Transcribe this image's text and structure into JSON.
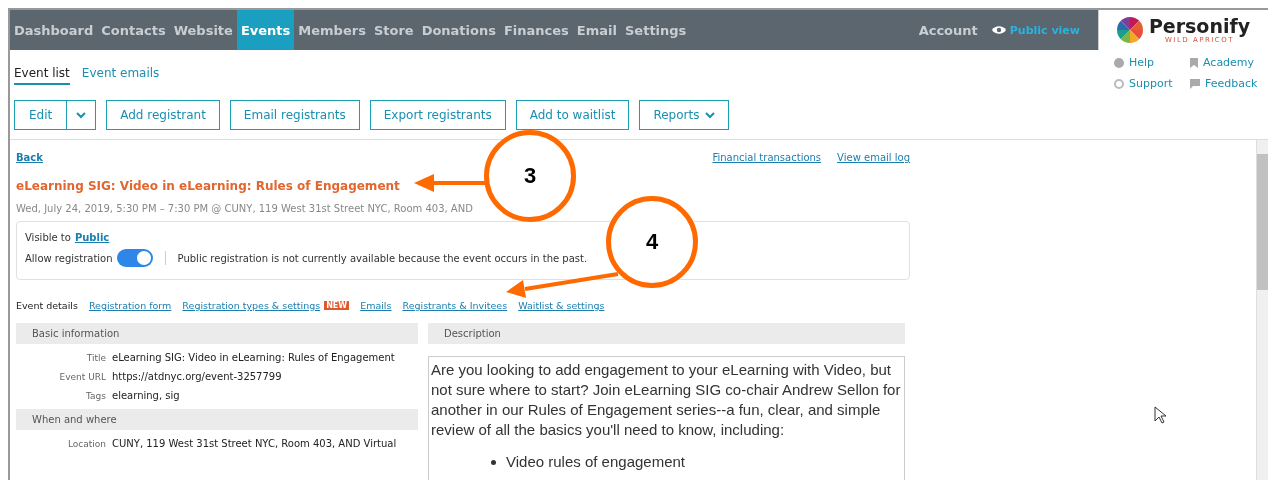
{
  "nav": {
    "items": [
      {
        "label": "Dashboard",
        "selected": false
      },
      {
        "label": "Contacts",
        "selected": false
      },
      {
        "label": "Website",
        "selected": false
      },
      {
        "label": "Events",
        "selected": true
      },
      {
        "label": "Members",
        "selected": false
      },
      {
        "label": "Store",
        "selected": false
      },
      {
        "label": "Donations",
        "selected": false
      },
      {
        "label": "Finances",
        "selected": false
      },
      {
        "label": "Email",
        "selected": false
      },
      {
        "label": "Settings",
        "selected": false
      }
    ],
    "account": "Account",
    "public_view": "Public view",
    "logo": {
      "name": "Personify",
      "tagline": "WILD APRICOT"
    }
  },
  "help_links": [
    {
      "label": "Help",
      "kind": "help"
    },
    {
      "label": "Academy",
      "kind": "bookmark"
    },
    {
      "label": "Support",
      "kind": "lifebuoy"
    },
    {
      "label": "Feedback",
      "kind": "comment"
    }
  ],
  "subtabs": [
    {
      "label": "Event list",
      "selected": true
    },
    {
      "label": "Event emails",
      "selected": false
    }
  ],
  "toolbar": [
    {
      "label": "Edit",
      "kind": "split"
    },
    {
      "label": "Add registrant",
      "kind": "plain"
    },
    {
      "label": "Email registrants",
      "kind": "plain"
    },
    {
      "label": "Export registrants",
      "kind": "plain"
    },
    {
      "label": "Add to waitlist",
      "kind": "plain"
    },
    {
      "label": "Reports",
      "kind": "dropdown"
    }
  ],
  "back": "Back",
  "top_links": [
    "Financial transactions",
    "View email log"
  ],
  "event": {
    "title": "eLearning SIG: Video in eLearning: Rules of Engagement",
    "when": "Wed, July 24, 2019, 5:30 PM – 7:30 PM @ CUNY, 119 West 31st Street NYC, Room 403, AND"
  },
  "visibility": {
    "label": "Visible to",
    "value": "Public",
    "allow_label": "Allow registration",
    "allow_registration": true,
    "note": "Public registration is not currently available because the event occurs in the past."
  },
  "detail_tabs": [
    {
      "label": "Event details",
      "selected": true
    },
    {
      "label": "Registration form",
      "selected": false
    },
    {
      "label": "Registration types & settings",
      "selected": false,
      "badge": "NEW"
    },
    {
      "label": "Emails",
      "selected": false
    },
    {
      "label": "Registrants & Invitees",
      "selected": false
    },
    {
      "label": "Waitlist & settings",
      "selected": false
    }
  ],
  "sections": [
    {
      "heading": "Basic information",
      "fields": [
        {
          "label": "Title",
          "value": "eLearning SIG: Video in eLearning: Rules of Engagement"
        },
        {
          "label": "Event URL",
          "value": "https://atdnyc.org/event-3257799"
        },
        {
          "label": "Tags",
          "value": "elearning, sig"
        }
      ]
    },
    {
      "heading": "When and where",
      "fields": [
        {
          "label": "Location",
          "value": "CUNY, 119 West 31st Street NYC, Room 403, AND Virtual"
        }
      ]
    }
  ],
  "description": {
    "heading": "Description",
    "text": "Are you looking to add engagement to your eLearning with Video, but not sure where to start? Join eLearning SIG co-chair Andrew Sellon for another in our Rules of Engagement series--a fun, clear, and simple review of all the basics you'll need to know, including:",
    "bullets": [
      "Video rules of engagement"
    ]
  },
  "callouts": [
    "3",
    "4"
  ]
}
